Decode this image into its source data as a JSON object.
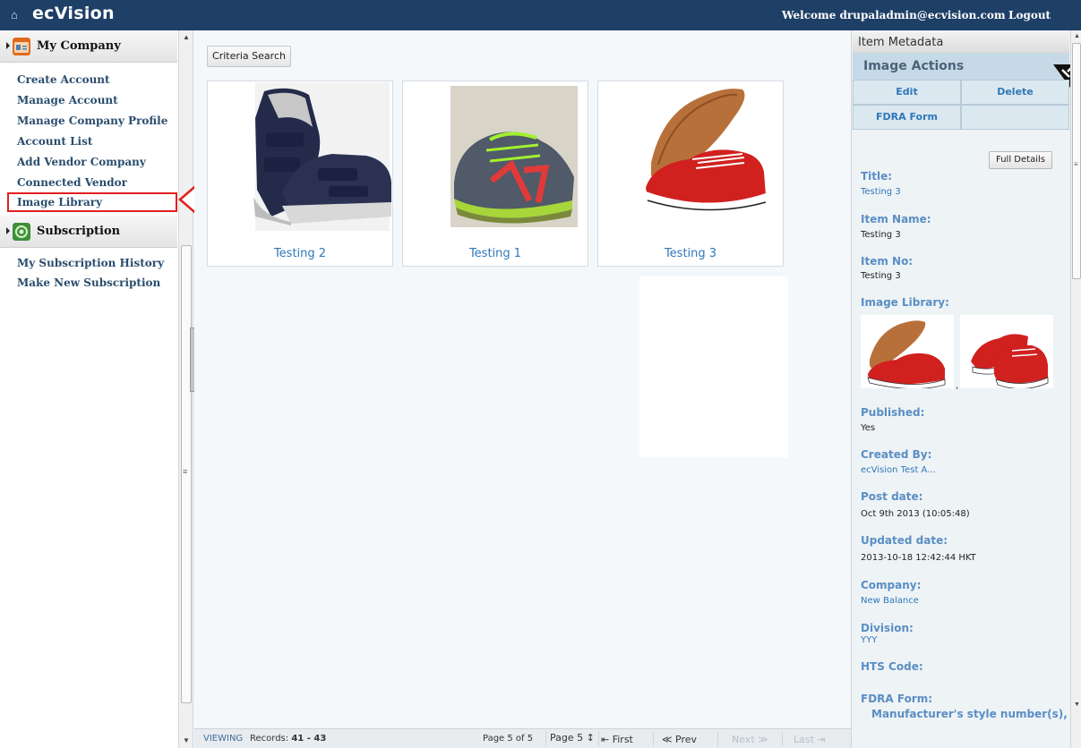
{
  "header": {
    "home_icon": "home-icon",
    "logo": "ecVision",
    "welcome": "Welcome drupaladmin@ecvision.com",
    "logout": "Logout"
  },
  "sidebar": {
    "sections": [
      {
        "title": "My Company",
        "icon": "company-icon",
        "items": [
          {
            "label": "Create Account"
          },
          {
            "label": "Manage Account"
          },
          {
            "label": "Manage Company Profile"
          },
          {
            "label": "Account List"
          },
          {
            "label": "Add Vendor Company"
          },
          {
            "label": "Connected Vendor"
          },
          {
            "label": "Image Library",
            "active": true
          }
        ]
      },
      {
        "title": "Subscription",
        "icon": "subscription-icon",
        "items": [
          {
            "label": "My Subscription History"
          },
          {
            "label": "Make New Subscription"
          }
        ]
      }
    ]
  },
  "main": {
    "criteria_button": "Criteria Search",
    "cards": [
      {
        "label": "Testing 2"
      },
      {
        "label": "Testing 1"
      },
      {
        "label": "Testing 3"
      }
    ]
  },
  "pager": {
    "viewing": "VIEWING",
    "records_label": "Records:",
    "records_range": "41 - 43",
    "page_of": "Page 5 of 5",
    "page_select": "Page 5",
    "first": "First",
    "prev": "Prev",
    "next": "Next",
    "last": "Last"
  },
  "right_panel": {
    "title": "Item Metadata",
    "actions_title": "Image Actions",
    "actions": {
      "edit": "Edit",
      "delete": "Delete",
      "fdra": "FDRA Form"
    },
    "full_details": "Full Details",
    "fields": {
      "title_label": "Title:",
      "title_value": "Testing 3",
      "item_name_label": "Item Name:",
      "item_name_value": "Testing 3",
      "item_no_label": "Item No:",
      "item_no_value": "Testing 3",
      "image_library_label": "Image Library:",
      "image_library_sep": ",",
      "published_label": "Published:",
      "published_value": "Yes",
      "created_by_label": "Created By:",
      "created_by_value": "ecVision Test A...",
      "post_date_label": "Post date:",
      "post_date_value": "Oct 9th 2013 (10:05:48)",
      "updated_date_label": "Updated date:",
      "updated_date_value": "2013-10-18 12:42:44 HKT",
      "company_label": "Company:",
      "company_value": "New Balance",
      "division_label": "Division:",
      "division_value": "YYY",
      "hts_label": "HTS Code:",
      "fdra_label": "FDRA Form:",
      "fdra_value": "Manufacturer's style number(s),"
    }
  },
  "colors": {
    "header_bg": "#1e3f66",
    "nav_link": "#2a4d6e",
    "card_label": "#2f77b8",
    "field_label": "#5a8ec4",
    "highlight": "#e02020",
    "actions_bg": "#c5d9e6"
  }
}
